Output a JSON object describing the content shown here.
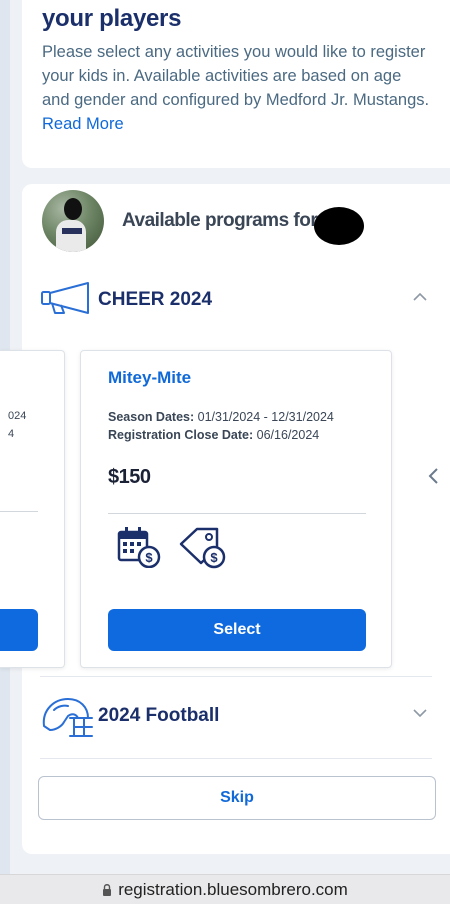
{
  "intro": {
    "title": "your players",
    "text": "Please select any activities you would like to register your kids in. Available activities are based on age and gender and configured by Medford Jr. Mustangs.",
    "read_more": "Read More"
  },
  "programs": {
    "heading": "Available programs for",
    "sections": [
      {
        "title": "CHEER 2024",
        "icon": "megaphone-icon",
        "expanded": true,
        "cards": [
          {
            "partial_line1": "024",
            "partial_line2": "4"
          },
          {
            "name": "Mitey-Mite",
            "season_label": "Season Dates:",
            "season_value": "01/31/2024 - 12/31/2024",
            "close_label": "Registration Close Date:",
            "close_value": "06/16/2024",
            "price": "$150",
            "icons": [
              "calendar-dollar-icon",
              "price-tag-icon"
            ],
            "button": "Select"
          }
        ]
      },
      {
        "title": "2024 Football",
        "icon": "football-helmet-icon",
        "expanded": false
      }
    ],
    "skip": "Skip"
  },
  "browser": {
    "url": "registration.bluesombrero.com"
  },
  "colors": {
    "primary": "#0f6ae0",
    "heading": "#1b2f6b",
    "link": "#1069d8"
  }
}
